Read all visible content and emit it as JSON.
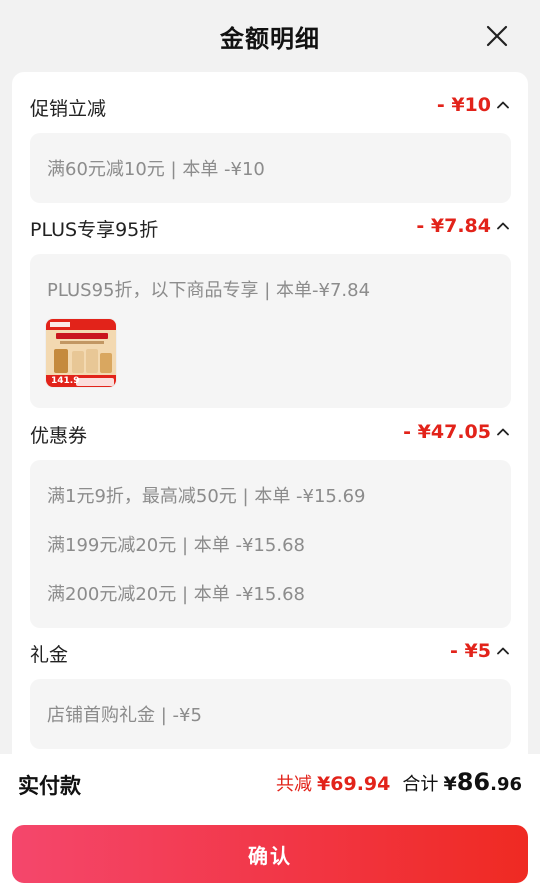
{
  "header": {
    "title": "金额明细",
    "close_icon": "close-icon"
  },
  "sections": [
    {
      "label": "促销立减",
      "amount": "- ¥10",
      "lines": [
        "满60元减10元 | 本单 -¥10"
      ]
    },
    {
      "label": "PLUS专享95折",
      "amount": "- ¥7.84",
      "lines": [
        "PLUS95折，以下商品专享 | 本单-¥7.84"
      ],
      "thumb_price": "141.9"
    },
    {
      "label": "优惠券",
      "amount": "- ¥47.05",
      "lines": [
        "满1元9折，最高减50元 | 本单 -¥15.69",
        "满199元减20元 | 本单 -¥15.68",
        "满200元减20元 | 本单 -¥15.68"
      ]
    },
    {
      "label": "礼金",
      "amount": "- ¥5",
      "lines": [
        "店铺首购礼金 | -¥5"
      ]
    }
  ],
  "footer": {
    "pay_label": "实付款",
    "reduce_label": "共减",
    "reduce_value": "¥69.94",
    "sum_label": "合计",
    "sum_currency": "¥",
    "sum_int": "86",
    "sum_dec": ".96",
    "confirm_label": "确认"
  },
  "colors": {
    "accent": "#e2231a",
    "button_start": "#f4476c",
    "button_end": "#ef2a22"
  }
}
